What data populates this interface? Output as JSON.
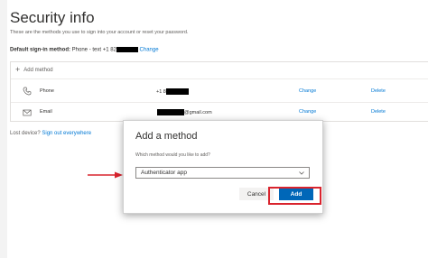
{
  "header": {
    "title": "Security info",
    "subtitle": "These are the methods you use to sign into your account or reset your password."
  },
  "default_method": {
    "label": "Default sign-in method:",
    "value": "Phone - text +1 82",
    "change_link": "Change"
  },
  "methods": {
    "add_label": "Add method",
    "rows": [
      {
        "icon": "phone-icon",
        "label": "Phone",
        "value_prefix": "+1 8",
        "value_suffix": "",
        "change": "Change",
        "delete": "Delete"
      },
      {
        "icon": "email-icon",
        "label": "Email",
        "value_prefix": "",
        "value_suffix": "@gmail.com",
        "change": "Change",
        "delete": "Delete"
      }
    ]
  },
  "lost_device": {
    "text": "Lost device?",
    "link": "Sign out everywhere"
  },
  "dialog": {
    "title": "Add a method",
    "question": "Which method would you like to add?",
    "selected_option": "Authenticator app",
    "cancel_label": "Cancel",
    "add_label": "Add"
  },
  "colors": {
    "accent": "#0078d4",
    "primary_button": "#0067b8",
    "annotation_red": "#d9232d"
  }
}
